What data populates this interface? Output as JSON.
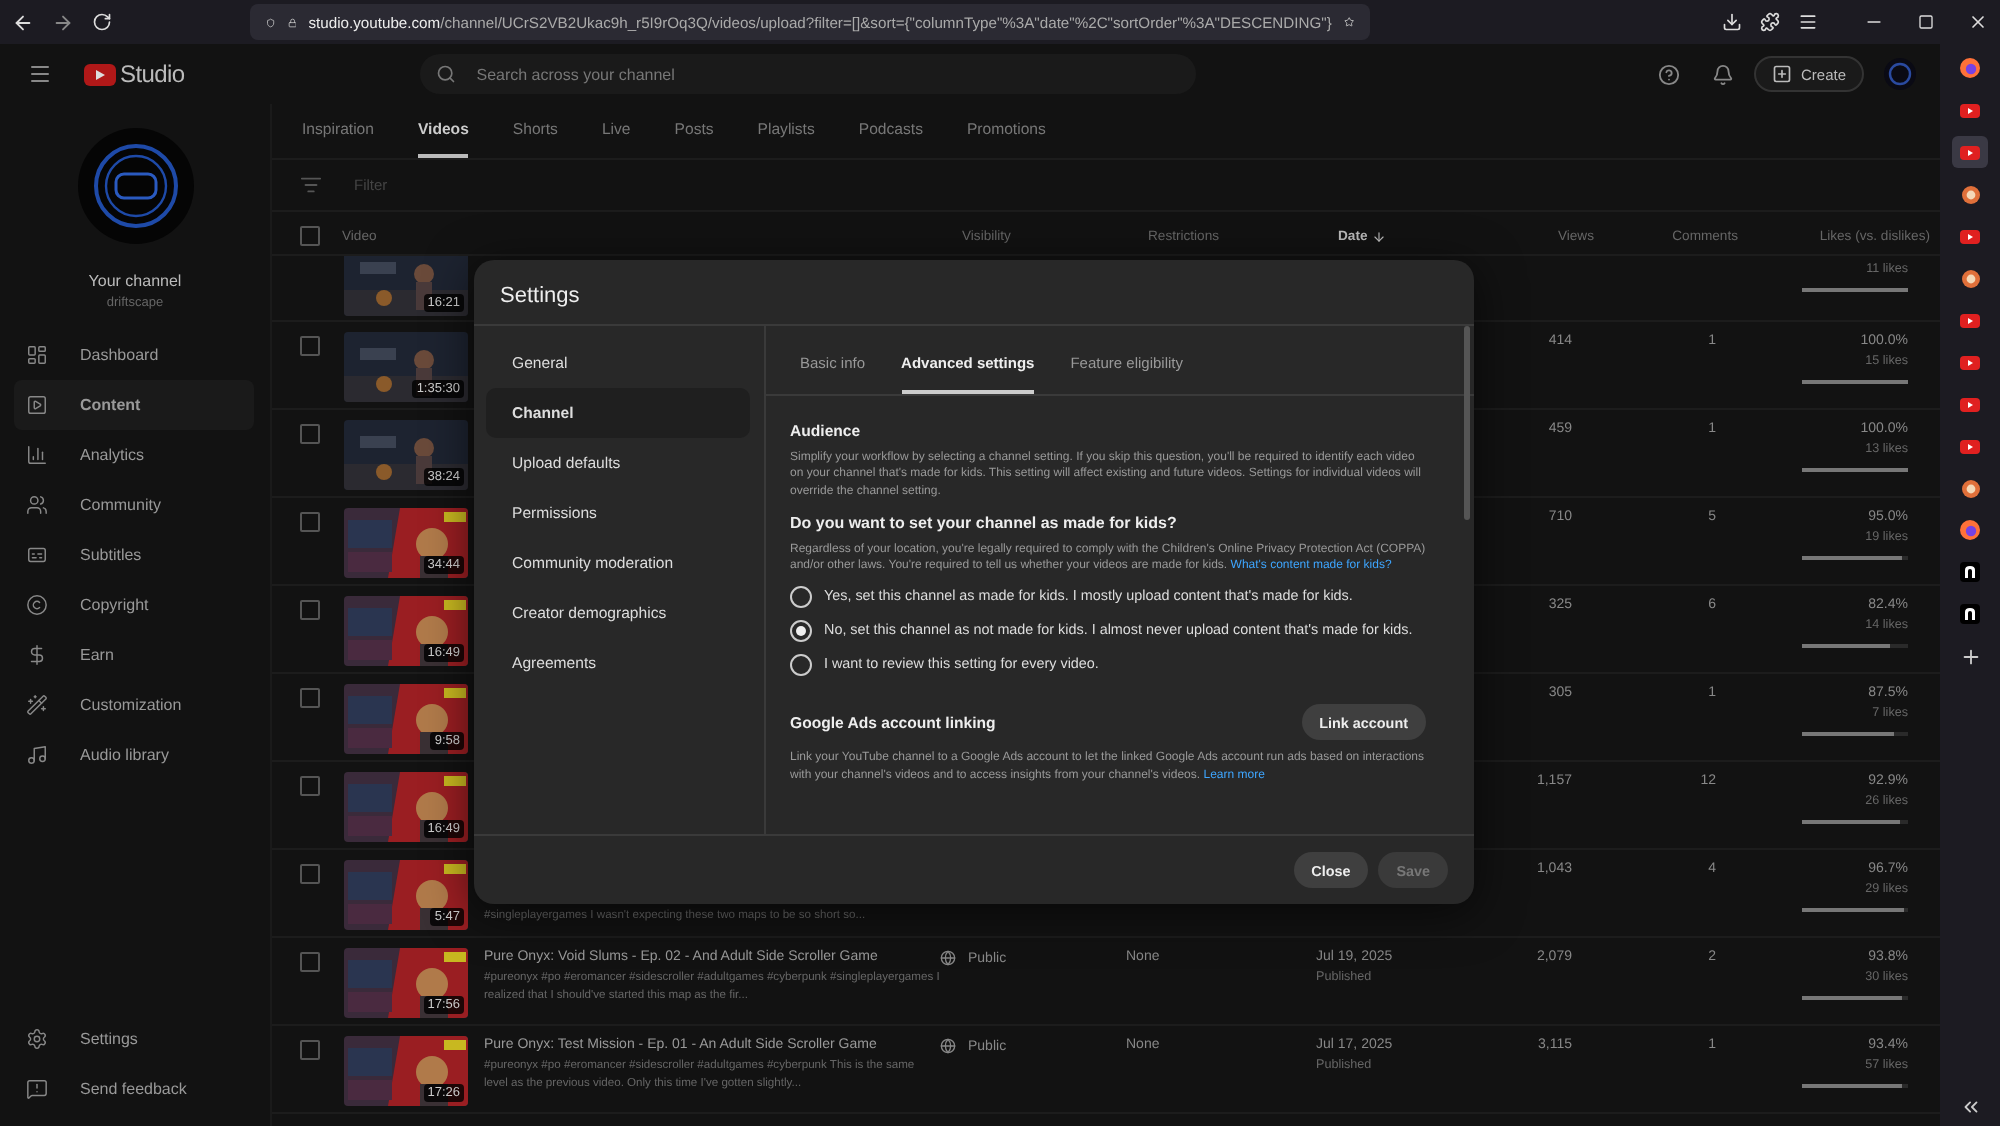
{
  "browser": {
    "url": {
      "host": "studio.youtube.com",
      "path": "/channel/UCrS2VB2Ukac9h_r5I9rOq3Q/videos/upload?filter=[]&sort={\"columnType\"%3A\"date\"%2C\"sortOrder\"%3A\"DESCENDING\"}"
    },
    "rail": [
      {
        "kind": "firefox",
        "selected": false
      },
      {
        "kind": "youtube",
        "selected": false
      },
      {
        "kind": "youtube",
        "selected": true
      },
      {
        "kind": "avatar",
        "selected": false
      },
      {
        "kind": "youtube",
        "selected": false
      },
      {
        "kind": "avatar",
        "selected": false
      },
      {
        "kind": "youtube",
        "selected": false
      },
      {
        "kind": "youtube",
        "selected": false
      },
      {
        "kind": "youtube",
        "selected": false
      },
      {
        "kind": "youtube",
        "selected": false
      },
      {
        "kind": "avatar",
        "selected": false
      },
      {
        "kind": "firefox",
        "selected": false
      },
      {
        "kind": "n",
        "selected": false
      },
      {
        "kind": "n",
        "selected": false
      },
      {
        "kind": "add",
        "selected": false
      }
    ]
  },
  "header": {
    "logo": "Studio",
    "search": {
      "placeholder": "Search across your channel"
    },
    "create": "Create"
  },
  "sidebar": {
    "channel_label": "Your channel",
    "channel_name": "driftscape",
    "items": [
      {
        "label": "Dashboard",
        "selected": false
      },
      {
        "label": "Content",
        "selected": true
      },
      {
        "label": "Analytics",
        "selected": false
      },
      {
        "label": "Community",
        "selected": false
      },
      {
        "label": "Subtitles",
        "selected": false
      },
      {
        "label": "Copyright",
        "selected": false
      },
      {
        "label": "Earn",
        "selected": false
      },
      {
        "label": "Customization",
        "selected": false
      },
      {
        "label": "Audio library",
        "selected": false
      }
    ],
    "footer_items": [
      "Settings",
      "Send feedback"
    ]
  },
  "tabs": [
    {
      "label": "Inspiration",
      "selected": false
    },
    {
      "label": "Videos",
      "selected": true
    },
    {
      "label": "Shorts",
      "selected": false
    },
    {
      "label": "Live",
      "selected": false
    },
    {
      "label": "Posts",
      "selected": false
    },
    {
      "label": "Playlists",
      "selected": false
    },
    {
      "label": "Podcasts",
      "selected": false
    },
    {
      "label": "Promotions",
      "selected": false
    }
  ],
  "filter": {
    "placeholder": "Filter"
  },
  "table": {
    "columns": [
      "Video",
      "Visibility",
      "Restrictions",
      "Date",
      "Views",
      "Comments",
      "Likes (vs. dislikes)"
    ],
    "header_checked": false,
    "rows": [
      {
        "duration": "16:21",
        "likes_count": "11 likes",
        "level": 1.0
      },
      {
        "checked": false,
        "duration": "1:35:30",
        "views": "414",
        "comments": "1",
        "likes": "100.0%",
        "likes_count": "15 likes",
        "level": 1.0
      },
      {
        "checked": false,
        "duration": "38:24",
        "views": "459",
        "comments": "1",
        "likes": "100.0%",
        "likes_count": "13 likes",
        "level": 1.0
      },
      {
        "checked": false,
        "duration": "34:44",
        "views": "710",
        "comments": "5",
        "likes": "95.0%",
        "likes_count": "19 likes",
        "level": 0.95
      },
      {
        "checked": false,
        "duration": "16:49",
        "views": "325",
        "comments": "6",
        "likes": "82.4%",
        "likes_count": "14 likes",
        "level": 0.824
      },
      {
        "checked": false,
        "duration": "9:58",
        "views": "305",
        "comments": "1",
        "likes": "87.5%",
        "likes_count": "7 likes",
        "level": 0.875
      },
      {
        "checked": false,
        "duration": "16:49",
        "views": "1,157",
        "comments": "12",
        "likes": "92.9%",
        "likes_count": "26 likes",
        "level": 0.929
      },
      {
        "checked": false,
        "duration": "5:47",
        "description": "#singleplayergames I wasn't expecting these two maps to be so short so...",
        "views": "1,043",
        "comments": "4",
        "likes": "96.7%",
        "likes_count": "29 likes",
        "level": 0.967
      },
      {
        "checked": false,
        "duration": "17:56",
        "title": "Pure Onyx: Void Slums - Ep. 02 - And Adult Side Scroller Game",
        "description": "#pureonyx #po #eromancer #sidescroller #adultgames #cyberpunk #singleplayergames I realized that I should've started this map as the fir...",
        "visibility": "Public",
        "restrictions": "None",
        "date": "Jul 19, 2025",
        "date_status": "Published",
        "views": "2,079",
        "comments": "2",
        "likes": "93.8%",
        "likes_count": "30 likes",
        "level": 0.938
      },
      {
        "checked": false,
        "duration": "17:26",
        "title": "Pure Onyx: Test Mission - Ep. 01 - An Adult Side Scroller Game",
        "description": "#pureonyx #po #eromancer #sidescroller #adultgames #cyberpunk This is the same level as the previous video. Only this time I've gotten slightly...",
        "visibility": "Public",
        "restrictions": "None",
        "date": "Jul 17, 2025",
        "date_status": "Published",
        "views": "3,115",
        "comments": "1",
        "likes": "93.4%",
        "likes_count": "57 likes",
        "level": 0.934
      }
    ]
  },
  "dialog": {
    "title": "Settings",
    "nav": [
      {
        "label": "General",
        "selected": false
      },
      {
        "label": "Channel",
        "selected": true
      },
      {
        "label": "Upload defaults",
        "selected": false
      },
      {
        "label": "Permissions",
        "selected": false
      },
      {
        "label": "Community moderation",
        "selected": false
      },
      {
        "label": "Creator demographics",
        "selected": false
      },
      {
        "label": "Agreements",
        "selected": false
      }
    ],
    "tabs": [
      {
        "label": "Basic info",
        "selected": false
      },
      {
        "label": "Advanced settings",
        "selected": true
      },
      {
        "label": "Feature eligibility",
        "selected": false
      }
    ],
    "audience": {
      "heading": "Audience",
      "intro": "Simplify your workflow by selecting a channel setting. If you skip this question, you'll be required to identify each video on your channel that's made for kids. This setting will affect existing and future videos. Settings for individual videos will override the channel setting.",
      "question": "Do you want to set your channel as made for kids?",
      "note": {
        "text": "Regardless of your location, you're legally required to comply with the Children's Online Privacy Protection Act (COPPA) and/or other laws. You're required to tell us whether your videos are made for kids.",
        "link": "What's content made for kids?"
      },
      "options": [
        {
          "label": "Yes, set this channel as made for kids. I mostly upload content that's made for kids.",
          "selected": false
        },
        {
          "label": "No, set this channel as not made for kids. I almost never upload content that's made for kids.",
          "selected": true
        },
        {
          "label": "I want to review this setting for every video.",
          "selected": false
        }
      ]
    },
    "ads": {
      "heading": "Google Ads account linking",
      "button": "Link account",
      "text": "Link your YouTube channel to a Google Ads account to let the linked Google Ads account run ads based on interactions with your channel's videos and to access insights from your channel's videos.",
      "link": "Learn more"
    },
    "buttons": [
      {
        "label": "Close",
        "disabled": false
      },
      {
        "label": "Save",
        "disabled": true
      }
    ]
  }
}
